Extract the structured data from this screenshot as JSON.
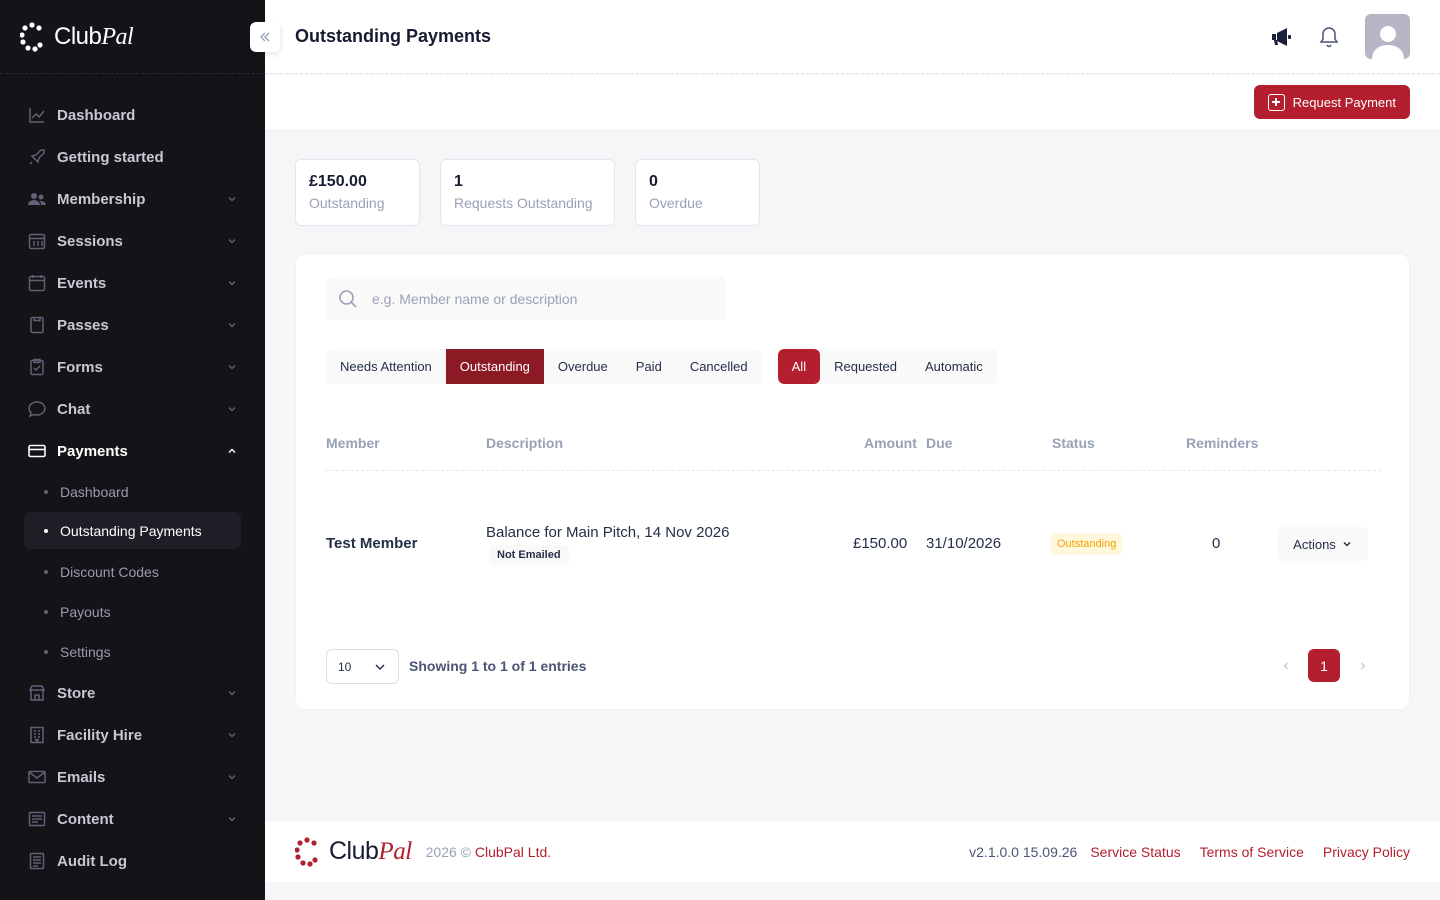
{
  "brand": {
    "name_plain": "Club",
    "name_italic": "Pal"
  },
  "sidebar": {
    "items": [
      {
        "label": "Dashboard"
      },
      {
        "label": "Getting started"
      },
      {
        "label": "Membership"
      },
      {
        "label": "Sessions"
      },
      {
        "label": "Events"
      },
      {
        "label": "Passes"
      },
      {
        "label": "Forms"
      },
      {
        "label": "Chat"
      },
      {
        "label": "Payments"
      },
      {
        "label": "Store"
      },
      {
        "label": "Facility Hire"
      },
      {
        "label": "Emails"
      },
      {
        "label": "Content"
      },
      {
        "label": "Audit Log"
      }
    ],
    "payments_sub": [
      {
        "label": "Dashboard"
      },
      {
        "label": "Outstanding Payments"
      },
      {
        "label": "Discount Codes"
      },
      {
        "label": "Payouts"
      },
      {
        "label": "Settings"
      }
    ]
  },
  "header": {
    "title": "Outstanding Payments"
  },
  "toolbar": {
    "request_label": "Request Payment"
  },
  "stats": [
    {
      "value": "£150.00",
      "label": "Outstanding"
    },
    {
      "value": "1",
      "label": "Requests Outstanding"
    },
    {
      "value": "0",
      "label": "Overdue"
    }
  ],
  "search": {
    "placeholder": "e.g. Member name or description"
  },
  "filters": {
    "status": [
      "Needs Attention",
      "Outstanding",
      "Overdue",
      "Paid",
      "Cancelled"
    ],
    "status_selected": "Outstanding",
    "type": [
      "All",
      "Requested",
      "Automatic"
    ],
    "type_selected": "All"
  },
  "table": {
    "columns": [
      "Member",
      "Description",
      "Amount",
      "Due",
      "Status",
      "Reminders"
    ],
    "rows": [
      {
        "member": "Test Member",
        "description": "Balance for Main Pitch, 14 Nov 2026",
        "email_badge": "Not Emailed",
        "amount": "£150.00",
        "due": "31/10/2026",
        "status": "Outstanding",
        "reminders": "0",
        "actions": "Actions"
      }
    ]
  },
  "pagination": {
    "page_size": "10",
    "summary": "Showing 1 to 1 of 1 entries",
    "current_page": "1"
  },
  "footer": {
    "year": "2026 ©",
    "company": "ClubPal Ltd.",
    "version": "v2.1.0.0 15.09.26",
    "links": [
      "Service Status",
      "Terms of Service",
      "Privacy Policy"
    ]
  },
  "colors": {
    "accent": "#b31f2e",
    "accent_dark": "#8c1a25",
    "sidebar_bg": "#131318",
    "status_outstanding": "#f6a100"
  }
}
